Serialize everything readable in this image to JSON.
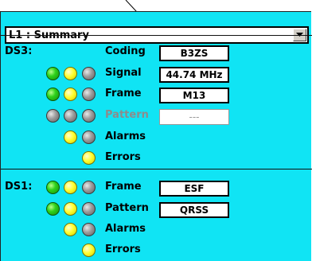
{
  "dropdown": {
    "value": "L1 : Summary"
  },
  "ds3": {
    "heading": "DS3:",
    "rows": [
      {
        "label": "Coding",
        "value": "B3ZS",
        "leds": [],
        "disabled": false
      },
      {
        "label": "Signal",
        "value": "44.74 MHz",
        "leds": [
          "green",
          "yellow",
          "gray"
        ],
        "disabled": false
      },
      {
        "label": "Frame",
        "value": "M13",
        "leds": [
          "green",
          "yellow",
          "gray"
        ],
        "disabled": false
      },
      {
        "label": "Pattern",
        "value": "---",
        "leds": [
          "gray",
          "gray",
          "gray"
        ],
        "disabled": true
      },
      {
        "label": "Alarms",
        "value": "",
        "leds": [
          "yellow",
          "gray"
        ],
        "disabled": false
      },
      {
        "label": "Errors",
        "value": "",
        "leds": [
          "yellow"
        ],
        "disabled": false
      }
    ]
  },
  "ds1": {
    "heading": "DS1:",
    "rows": [
      {
        "label": "Frame",
        "value": "ESF",
        "leds": [
          "green",
          "yellow",
          "gray"
        ],
        "disabled": false
      },
      {
        "label": "Pattern",
        "value": "QRSS",
        "leds": [
          "green",
          "yellow",
          "gray"
        ],
        "disabled": false
      },
      {
        "label": "Alarms",
        "value": "",
        "leds": [
          "yellow",
          "gray"
        ],
        "disabled": false
      },
      {
        "label": "Errors",
        "value": "",
        "leds": [
          "yellow"
        ],
        "disabled": false
      }
    ]
  },
  "colors": {
    "panel": "#10e4f4",
    "led_green": "#2fd21c",
    "led_yellow": "#ffff30",
    "led_gray": "#9a9a9a",
    "disabled_text": "#8c8c8c"
  }
}
